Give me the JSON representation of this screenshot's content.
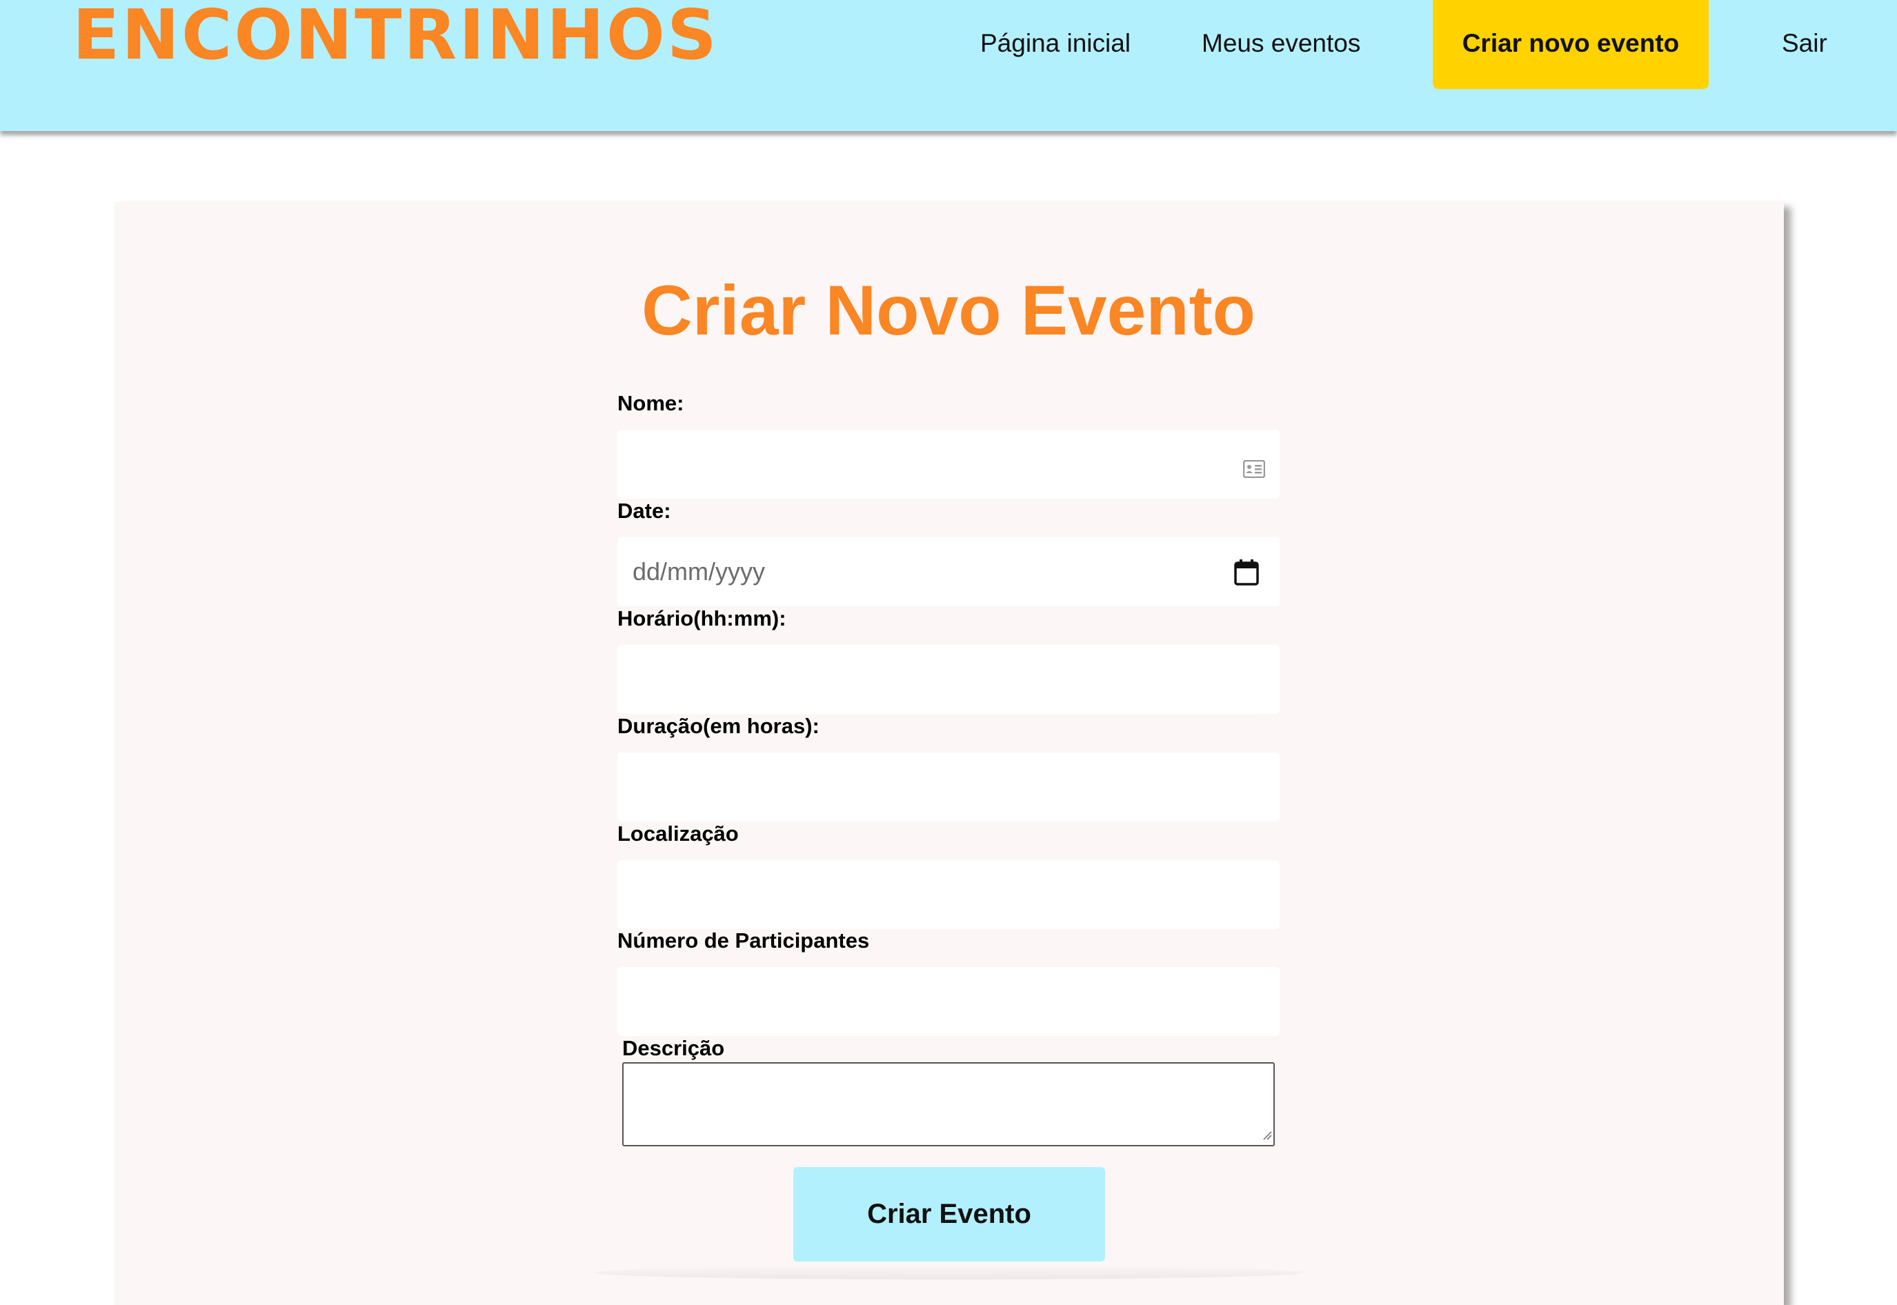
{
  "header": {
    "logo": "ENCONTRINHOS",
    "nav": {
      "home": "Página inicial",
      "my_events": "Meus eventos",
      "create_event": "Criar novo evento",
      "exit": "Sair"
    }
  },
  "form": {
    "title": "Criar Novo Evento",
    "name_label": "Nome:",
    "name_value": "",
    "name_icon": "contact-card-icon",
    "date_label": "Date:",
    "date_placeholder": "dd/mm/yyyy",
    "date_icon": "calendar-icon",
    "time_label": "Horário(hh:mm):",
    "time_value": "",
    "duration_label": "Duração(em horas):",
    "duration_value": "",
    "location_label": "Localização",
    "location_value": "",
    "participants_label": "Número de Participantes",
    "participants_value": "",
    "description_label": "Descrição",
    "description_value": "",
    "submit_label": "Criar Evento"
  },
  "colors": {
    "header_bg": "#b3f0fd",
    "brand_orange": "#fa8624",
    "active_nav_bg": "#ffd200",
    "card_bg": "#fcf7f6"
  }
}
